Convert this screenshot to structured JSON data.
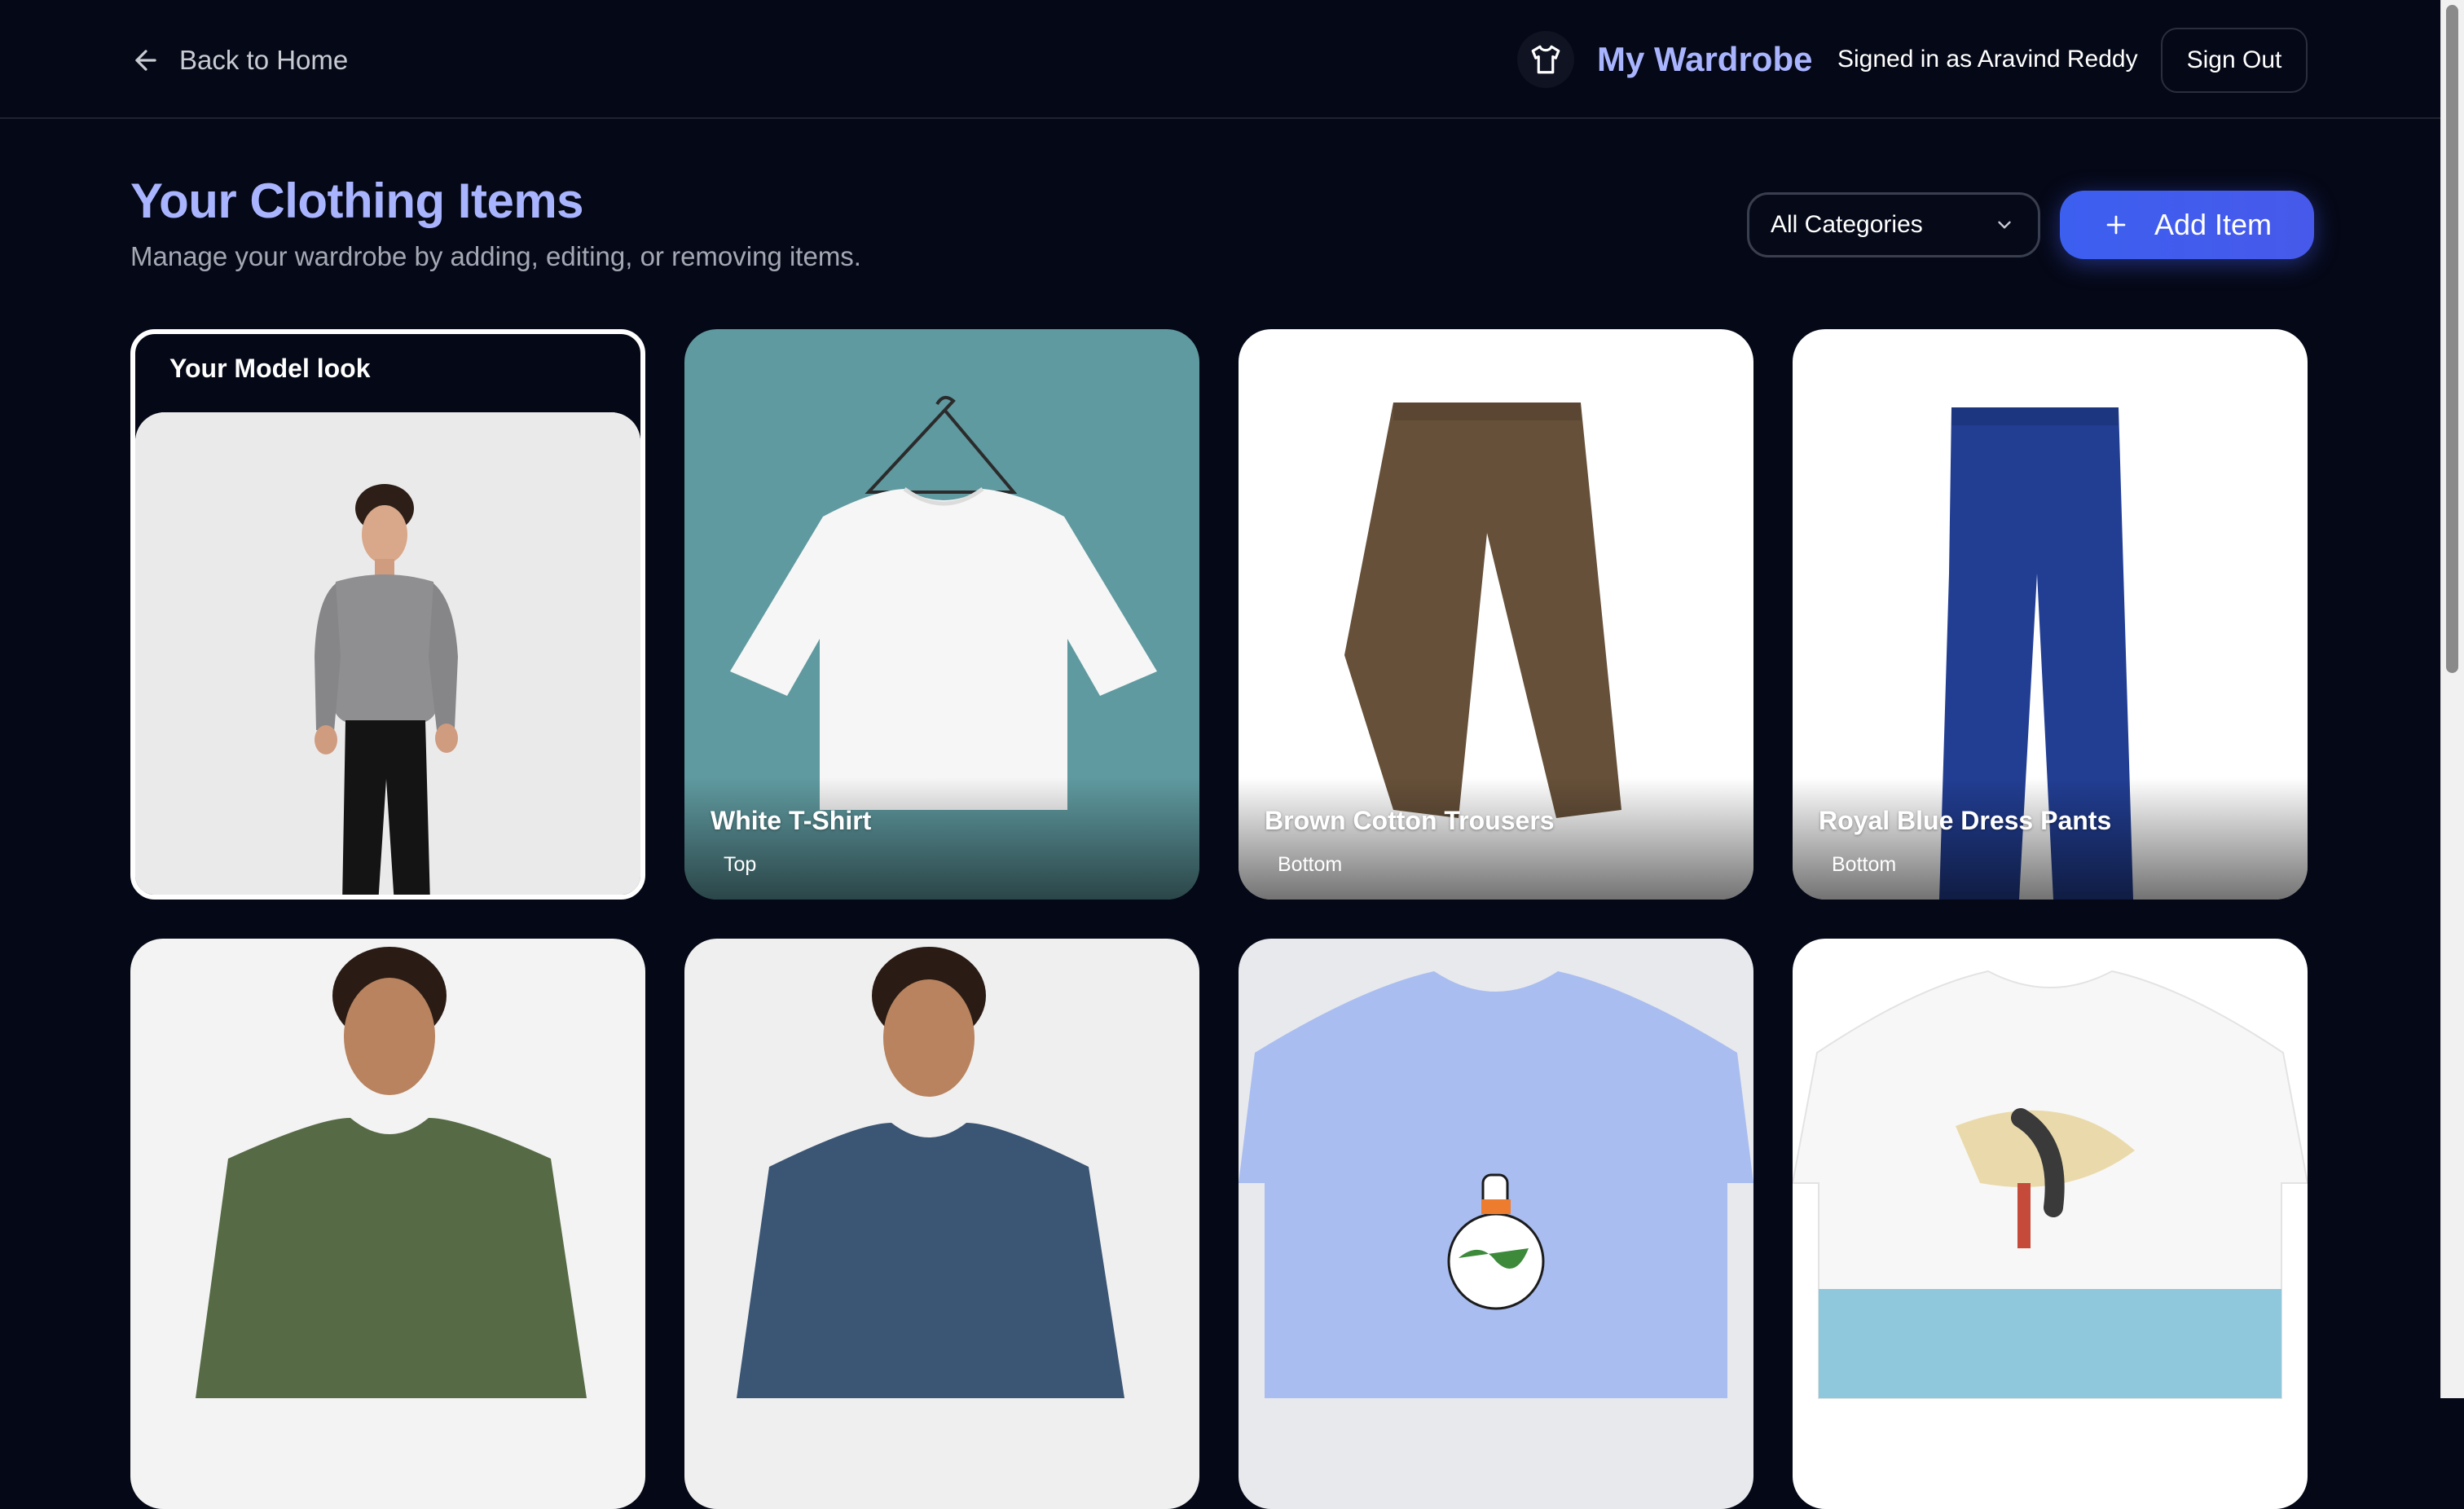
{
  "header": {
    "back_label": "Back to Home",
    "brand_title": "My Wardrobe",
    "signed_in_text": "Signed in as Aravind Reddy",
    "sign_out_label": "Sign Out"
  },
  "main": {
    "title": "Your Clothing Items",
    "subtitle": "Manage your wardrobe by adding, editing, or removing items.",
    "category_filter": "All Categories",
    "add_item_label": "Add Item",
    "model_card_label": "Your Model look"
  },
  "items": [
    {
      "name": "White T-Shirt",
      "category": "Top"
    },
    {
      "name": "Brown Cotton Trousers",
      "category": "Bottom"
    },
    {
      "name": "Royal Blue Dress Pants",
      "category": "Bottom"
    }
  ],
  "colors": {
    "accent": "#a9b4ff",
    "button": "#3c5ff0",
    "background": "#050816"
  },
  "icons": [
    "arrow-left-icon",
    "shirt-icon",
    "chevron-down-icon",
    "plus-icon"
  ]
}
